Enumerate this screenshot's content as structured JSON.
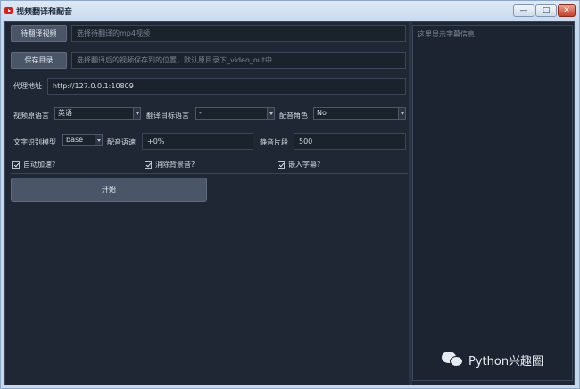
{
  "window": {
    "title": "视频翻译和配音",
    "controls": {
      "minimize": "—",
      "maximize": "□",
      "close": "✕"
    }
  },
  "actions": {
    "select_video_label": "待翻译视频",
    "video_placeholder": "选择待翻译的mp4视频",
    "save_dir_label": "保存目录",
    "save_dir_placeholder": "选择翻译后的视频保存到的位置，默认原目录下_video_out中"
  },
  "proxy": {
    "label": "代理地址",
    "value": "http://127.0.0.1:10809"
  },
  "languages": {
    "source_label": "视频原语言",
    "source_value": "英语",
    "target_label": "翻译目标语言",
    "target_value": "-",
    "voice_label": "配音角色",
    "voice_value": "No"
  },
  "recognition": {
    "model_label": "文字识别模型",
    "model_value": "base",
    "rate_label": "配音语速",
    "rate_value": "+0%",
    "silence_label": "静音片段",
    "silence_value": "500"
  },
  "options": {
    "auto_speed": {
      "label": "自动加速?",
      "checked": true
    },
    "remove_bgm": {
      "label": "消除背景音?",
      "checked": true
    },
    "embed_subs": {
      "label": "嵌入字幕?",
      "checked": true
    }
  },
  "start_label": "开始",
  "subtitle_panel": {
    "placeholder": "这里显示字幕信息"
  },
  "watermark": {
    "text": "Python兴趣圈",
    "icon": "wechat-icon"
  }
}
